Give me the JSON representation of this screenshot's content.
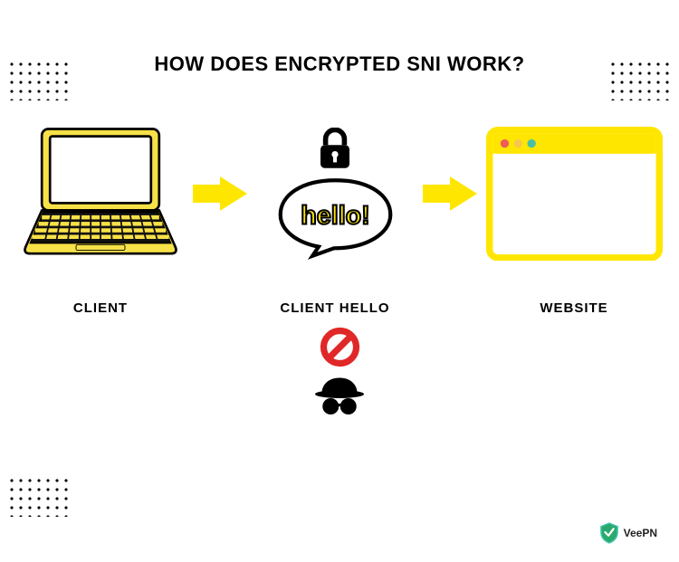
{
  "title": "HOW DOES ENCRYPTED SNI WORK?",
  "labels": {
    "client": "CLIENT",
    "client_hello": "CLIENT HELLO",
    "website": "WEBSITE"
  },
  "bubble_text": "hello!",
  "brand": "VeePN",
  "colors": {
    "yellow": "#ffe600",
    "prohibit": "#e02828"
  }
}
